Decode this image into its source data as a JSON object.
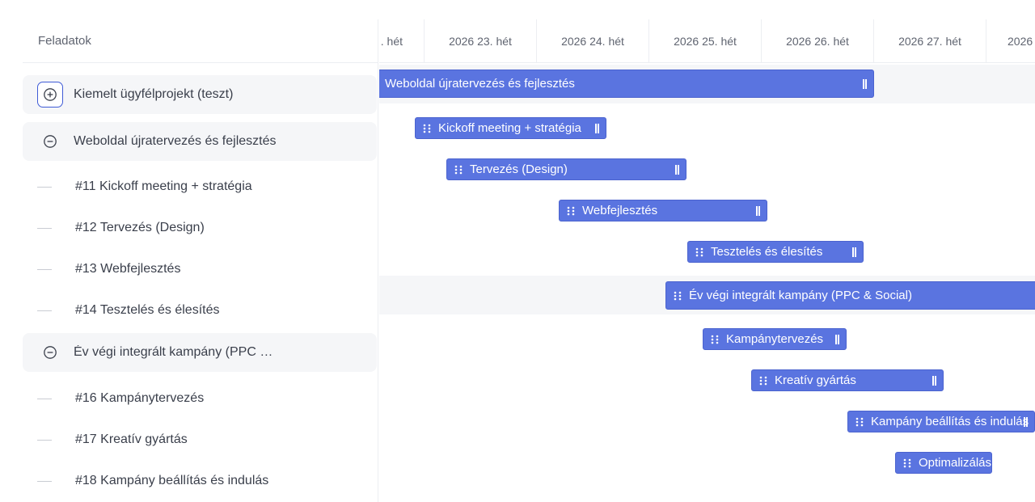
{
  "left_panel": {
    "header": "Feladatok",
    "rows": [
      {
        "kind": "group",
        "label": "Kiemelt ügyfélprojekt (teszt)",
        "icon": "plus-circle-icon"
      },
      {
        "kind": "group",
        "label": "Weboldal újratervezés és fejlesztés",
        "icon": "minus-circle-icon"
      },
      {
        "kind": "task",
        "label": "#11 Kickoff meeting + stratégia"
      },
      {
        "kind": "task",
        "label": "#12 Tervezés (Design)"
      },
      {
        "kind": "task",
        "label": "#13 Webfejlesztés"
      },
      {
        "kind": "task",
        "label": "#14 Tesztelés és élesítés"
      },
      {
        "kind": "group",
        "label": "Év végi integrált kampány (PPC …",
        "icon": "minus-circle-icon"
      },
      {
        "kind": "task",
        "label": "#16 Kampánytervezés"
      },
      {
        "kind": "task",
        "label": "#17 Kreatív gyártás"
      },
      {
        "kind": "task",
        "label": "#18 Kampány beállítás és indulás"
      }
    ]
  },
  "timeline": {
    "weeks": [
      ". hét",
      "2026 23. hét",
      "2026 24. hét",
      "2026 25. hét",
      "2026 26. hét",
      "2026 27. hét",
      "2026"
    ],
    "bars": [
      {
        "label": "Weboldal újratervezés és fejlesztés"
      },
      {
        "label": "Kickoff meeting + stratégia"
      },
      {
        "label": "Tervezés (Design)"
      },
      {
        "label": "Webfejlesztés"
      },
      {
        "label": "Tesztelés és élesítés"
      },
      {
        "label": "Év végi integrált kampány (PPC & Social)"
      },
      {
        "label": "Kampánytervezés"
      },
      {
        "label": "Kreatív gyártás"
      },
      {
        "label": "Kampány beállítás és indulás"
      },
      {
        "label": "Optimalizálás"
      }
    ]
  },
  "colors": {
    "bar_fill": "#5a74e0",
    "accent": "#3f5bd6",
    "group_row_bg": "#f5f6f8"
  }
}
